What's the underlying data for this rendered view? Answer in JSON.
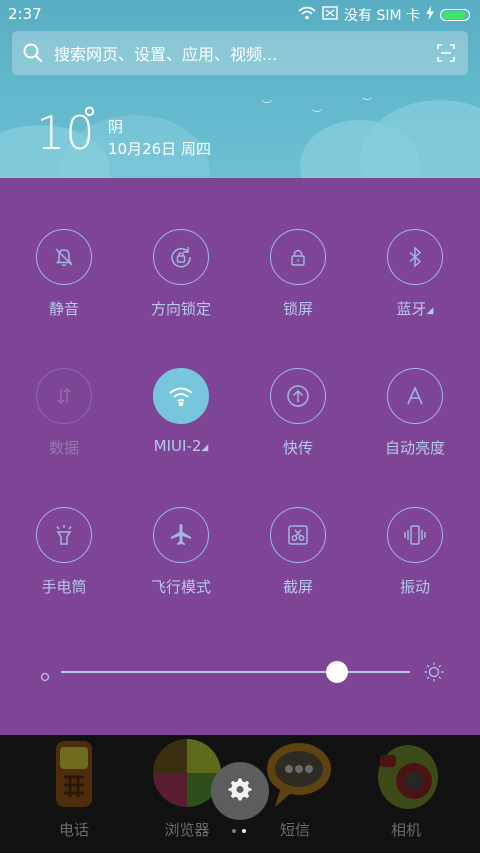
{
  "status_bar": {
    "time": "2:37",
    "carrier": "没有 SIM 卡",
    "battery_level": 0.95,
    "battery_color": "#3ee36b"
  },
  "search": {
    "placeholder": "搜索网页、设置、应用、视频..."
  },
  "weather": {
    "temperature": "10",
    "degree": "°",
    "condition": "阴",
    "date": "10月26日 周四"
  },
  "toggles": [
    {
      "label": "静音",
      "icon": "bell-muted-icon",
      "state": "off"
    },
    {
      "label": "方向锁定",
      "icon": "rotation-lock-icon",
      "state": "off"
    },
    {
      "label": "锁屏",
      "icon": "lock-icon",
      "state": "off"
    },
    {
      "label": "蓝牙",
      "icon": "bluetooth-icon",
      "state": "off",
      "has_more": true
    },
    {
      "label": "数据",
      "icon": "mobile-data-icon",
      "state": "disabled"
    },
    {
      "label": "MIUI-2",
      "icon": "wifi-icon",
      "state": "on",
      "has_more": true
    },
    {
      "label": "快传",
      "icon": "quick-transfer-icon",
      "state": "off"
    },
    {
      "label": "自动亮度",
      "icon": "auto-brightness-icon",
      "state": "off"
    },
    {
      "label": "手电筒",
      "icon": "flashlight-icon",
      "state": "off"
    },
    {
      "label": "飞行模式",
      "icon": "airplane-icon",
      "state": "off"
    },
    {
      "label": "截屏",
      "icon": "screenshot-icon",
      "state": "off"
    },
    {
      "label": "振动",
      "icon": "vibrate-icon",
      "state": "off"
    }
  ],
  "brightness": {
    "level": 0.79
  },
  "dock": [
    {
      "label": "电话",
      "icon": "phone-app-icon"
    },
    {
      "label": "浏览器",
      "icon": "browser-app-icon"
    },
    {
      "label": "短信",
      "icon": "messages-app-icon"
    },
    {
      "label": "相机",
      "icon": "camera-app-icon"
    }
  ],
  "page_indicator": {
    "pages": 2,
    "current": 2
  },
  "colors": {
    "panel": "#7e4597",
    "active_toggle": "#78c6db",
    "header": "#6cc0d2"
  }
}
